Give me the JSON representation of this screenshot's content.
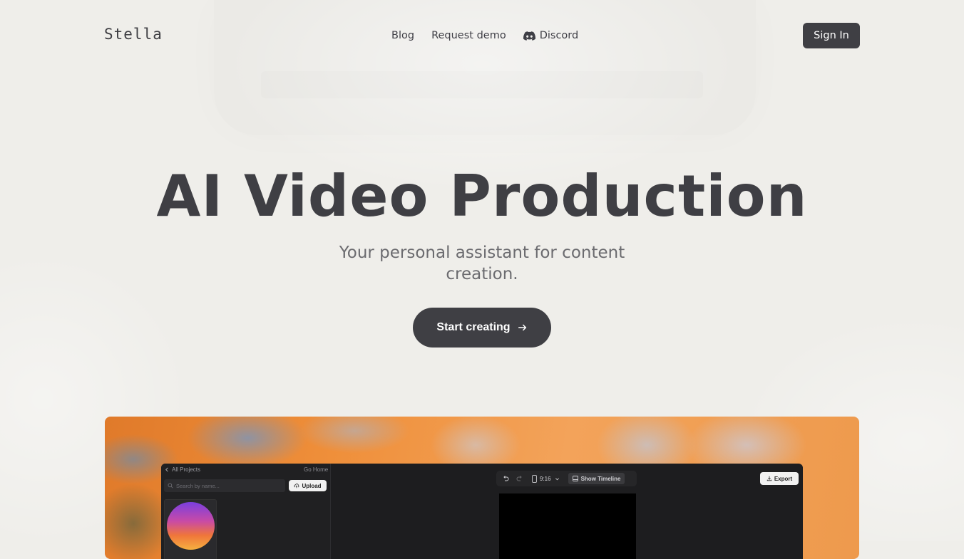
{
  "brand": {
    "name": "Stella"
  },
  "nav": {
    "items": [
      {
        "label": "Blog"
      },
      {
        "label": "Request demo"
      },
      {
        "label": "Discord",
        "icon": "discord-icon"
      }
    ],
    "signin_label": "Sign In"
  },
  "hero": {
    "title": "AI Video Production",
    "subtitle": "Your personal assistant for content creation.",
    "cta_label": "Start creating",
    "cta_icon": "arrow-right-icon"
  },
  "editor_preview": {
    "back_label": "All Projects",
    "go_home_label": "Go Home",
    "search_placeholder": "Search by name...",
    "upload_label": "Upload",
    "aspect_ratio": "9:16",
    "show_timeline_label": "Show Timeline",
    "export_label": "Export"
  },
  "colors": {
    "background": "#efeeea",
    "primary_dark": "#3f3f44",
    "text_muted": "#6b6b6f",
    "accent_orange": "#ef8f3a"
  }
}
